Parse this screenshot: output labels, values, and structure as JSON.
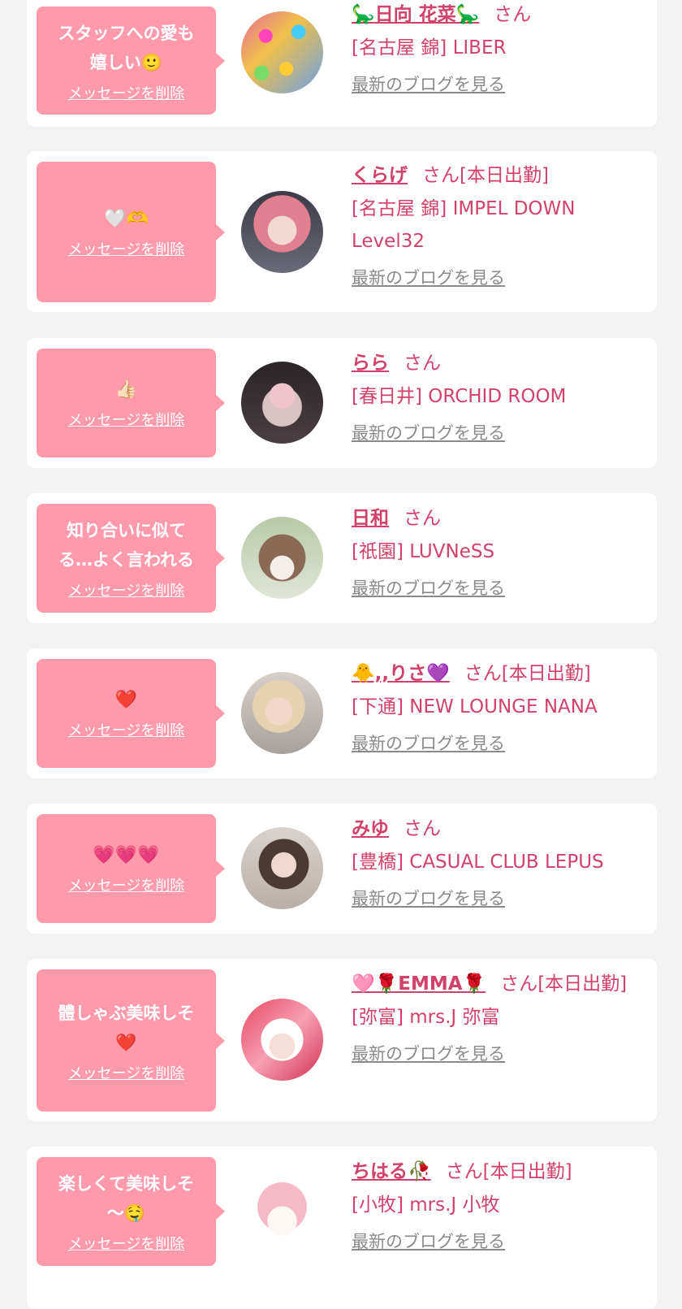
{
  "delete_label": "メッセージを削除",
  "blog_label": "最新のブログを見る",
  "san_suffix": "さん",
  "colors": {
    "background": "#f3f3f3",
    "card": "#ffffff",
    "bubble": "#ff9aab",
    "accent": "#d2416b",
    "link_gray": "#8a8a8a"
  },
  "items": [
    {
      "message": "スタッフへの愛も\n嬉しい🙂",
      "name": "🦕日向 花菜🦕",
      "status": "さん",
      "shop": "[名古屋 錦] LIBER",
      "avatar": "colorful-balls-photo"
    },
    {
      "message": "🤍🫶",
      "name": "くらげ",
      "status": "さん[本日出勤]",
      "shop": "[名古屋 錦] IMPEL DOWN Level32",
      "avatar": "pink-hair-photo"
    },
    {
      "message": "👍🏻",
      "name": "らら",
      "status": "さん",
      "shop": "[春日井] ORCHID ROOM",
      "avatar": "flower-mask-photo"
    },
    {
      "message": "知り合いに似て\nる…よく言われる",
      "name": "日和",
      "status": "さん",
      "shop": "[祇園] LUVNeSS",
      "avatar": "puppy-photo"
    },
    {
      "message": "❤️",
      "name": "🐥,,りさ💜",
      "status": "さん[本日出勤]",
      "shop": "[下通] NEW LOUNGE NANA",
      "avatar": "blonde-peace-photo"
    },
    {
      "message": "💗💗💗",
      "name": "みゆ",
      "status": "さん",
      "shop": "[豊橋] CASUAL CLUB LEPUS",
      "avatar": "dark-hair-photo"
    },
    {
      "message": "體しゃぶ美味しそ\n❤️",
      "name": "🩷🌹EMMA🌹",
      "status": "さん[本日出勤]",
      "shop": "[弥富] mrs.J 弥富",
      "avatar": "heart-frame-photo"
    },
    {
      "message": "楽しくて美味しそ\n〜🤤",
      "name": "ちはる🥀",
      "status": "さん[本日出勤]",
      "shop": "[小牧] mrs.J 小牧",
      "avatar": "my-melody-plush-photo"
    }
  ]
}
